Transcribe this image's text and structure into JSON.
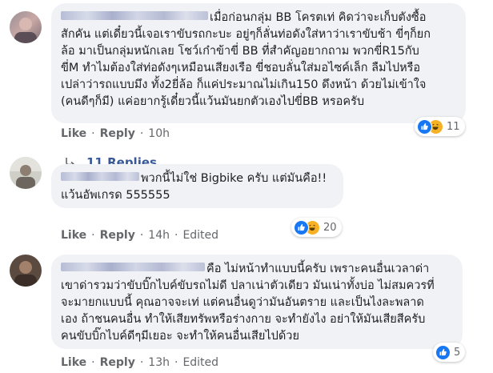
{
  "comments": [
    {
      "text": "เมื่อก่อนกลุ่ม BB โครตเท่ คิดว่าจะเก็บตังซื้อ สักคัน แต่เดี๋ยวนี้เจอเราขับรถกะบะ อยู่ๆก็ลั่นท่อดังใส่หาว่าเราขับช้า ขี่ๆก็ยก ล้อ มาเป็นกลุ่มหนักเลย โชว์เก๋าข้าขี่ BB ที่สำคัญอยากถาม พวกขี่R15กับ ขี่M ทำไมต้องใส่ท่อดังๆเหมือนเสียงเรือ ขี่ชอบลั่นใส่มอไซค์เล็ก ลืมไปหรือ เปล่าว่ารถแบบมึง ทั้ง2ยี่ล้อ ก็แค่ประมาณไม่เกิน150 ดึงหน้า ด้วยไม่เข้าใจ (คนดีๆก็มี) แค่อยากรู้เดี๋ยวนี้แว้นมันยกตัวเองไปขี่BB หรอครับ",
      "lines": [
        "เมื่อก่อนกลุ่ม BB โครตเท่ คิดว่าจะเก็บตังซื้อ",
        "สักคัน แต่เดี๋ยวนี้เจอเราขับรถกะบะ อยู่ๆก็ลั่นท่อดังใส่หาว่าเราขับช้า ขี่ๆก็ยก",
        "ล้อ มาเป็นกลุ่มหนักเลย โชว์เก๋าข้าขี่ BB ที่สำคัญอยากถาม พวกขี่R15กับ",
        "ขี่M ทำไมต้องใส่ท่อดังๆเหมือนเสียงเรือ ขี่ชอบลั่นใส่มอไซค์เล็ก ลืมไปหรือ",
        "เปล่าว่ารถแบบมึง ทั้ง2ยี่ล้อ ก็แค่ประมาณไม่เกิน150 ดึงหน้า ด้วยไม่เข้าใจ",
        "(คนดีๆก็มี) แค่อยากรู้เดี๋ยวนี้แว้นมันยกตัวเองไปขี่BB หรอครับ"
      ],
      "like_label": "Like",
      "reply_label": "Reply",
      "time": "10h",
      "edited": "",
      "reaction_count": "11",
      "reaction_icons": [
        "like-icon",
        "haha-icon"
      ]
    },
    {
      "lines": [
        "พวกนี้ไม่ใช่ Bigbike ครับ แต่มันคือ!!",
        "แว้นอัพเกรด 555555"
      ],
      "like_label": "Like",
      "reply_label": "Reply",
      "time": "14h",
      "edited": "Edited",
      "reaction_count": "20",
      "reaction_icons": [
        "like-icon",
        "haha-icon"
      ]
    },
    {
      "lines": [
        "คือ ไม่หน้าทำแบบนี้ครับ เพราะคนอื่นเวลาด่า",
        "เขาด่ารวมว่าขับบิ๊กไบค์ขับรถไม่ดี ปลาเน่าตัวเดียว มันเน่าทั้งบ่อ ไม่สมควรที่",
        "จะมายกแบบนี้ คุณอาจจะเท่ แต่คนอื่นดูว่ามันอันตราย และเป็นไงละพลาด",
        "เอง ถ้าชนคนอื่น ทำให้เสียทรัพหรือร่างกาย จะทำยังไง อย่าให้มันเสียสีครับ",
        "คนขับบิ๊กไบค์ดีๆมีเยอะ จะทำให้คนอื่นเสียไปด้วย"
      ],
      "like_label": "Like",
      "reply_label": "Reply",
      "time": "13h",
      "edited": "Edited",
      "reaction_count": "5",
      "reaction_icons": [
        "like-icon"
      ]
    }
  ],
  "replies_link": "11 Replies",
  "colors": {
    "bubble": "#f0f2f5",
    "meta_text": "#65676b",
    "link": "#385898",
    "like_blue": "#1877f2",
    "haha_yellow": "#f7b125"
  }
}
